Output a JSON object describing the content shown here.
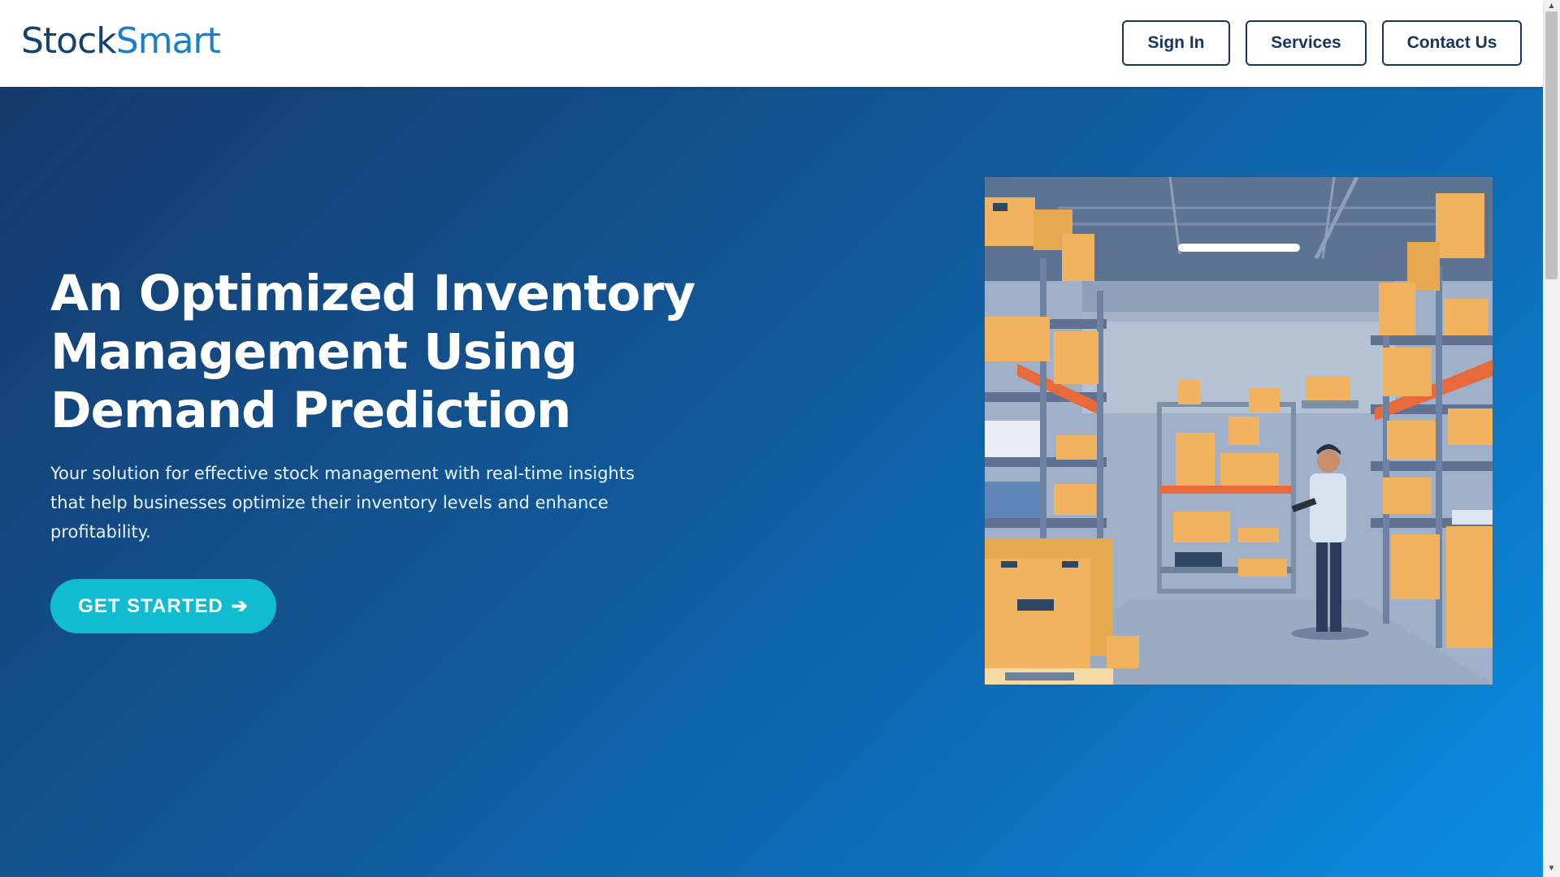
{
  "brand": {
    "part1": "Stock",
    "part2": "Smart",
    "color_primary": "#12426f",
    "color_accent": "#1b7fc7"
  },
  "nav": {
    "sign_in": "Sign In",
    "services": "Services",
    "contact": "Contact Us"
  },
  "hero": {
    "title": "An Optimized Inventory Management Using Demand Prediction",
    "subtitle": "Your solution for effective stock management with real-time insights that help businesses optimize their inventory levels and enhance profitability.",
    "cta_label": "GET STARTED",
    "cta_arrow": "➔",
    "cta_color": "#11bcd0",
    "illustration": "warehouse-illustration"
  },
  "scrollbar": {
    "up": "▲",
    "down": "▼"
  }
}
